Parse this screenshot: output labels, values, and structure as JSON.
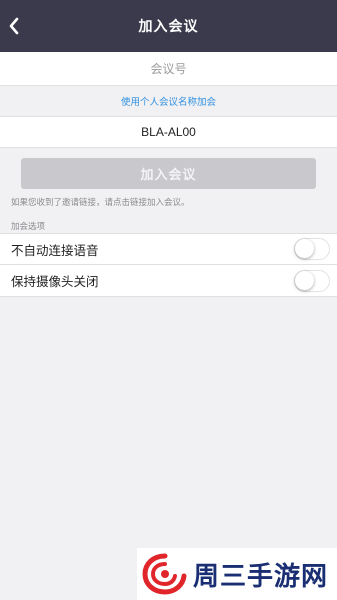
{
  "header": {
    "back_icon": "chevron-left-icon",
    "title": "加入会议"
  },
  "meeting_number": {
    "placeholder": "会议号",
    "value": ""
  },
  "personal_name_link": "使用个人会议名称加会",
  "display_name": {
    "value": "BLA-AL00"
  },
  "join_button": {
    "label": "加入会议",
    "enabled": false
  },
  "invite_hint": "如果您收到了邀请链接，请点击链接加入会议。",
  "options": {
    "section_title": "加会选项",
    "items": [
      {
        "label": "不自动连接语音",
        "on": false
      },
      {
        "label": "保持摄像头关闭",
        "on": false
      }
    ]
  },
  "watermark": {
    "text": "周三手游网"
  },
  "colors": {
    "header_bg": "#3a3a4c",
    "link": "#2f8fe0",
    "disabled_button": "#c9c9cd",
    "page_bg": "#f1f1f3",
    "watermark_text": "#1a2f73",
    "watermark_logo": "#e0262b"
  }
}
